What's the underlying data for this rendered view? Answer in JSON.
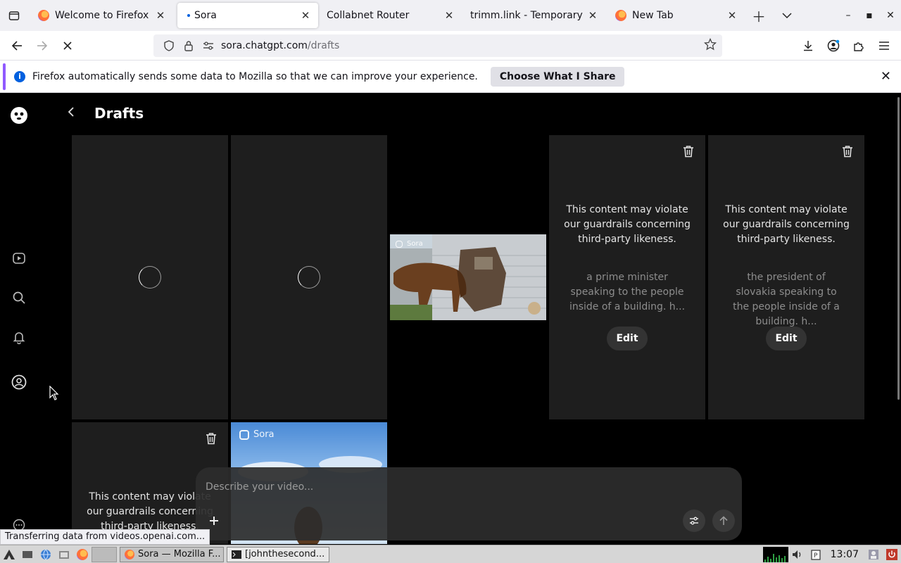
{
  "browser": {
    "tabs": [
      {
        "title": "Welcome to Firefox",
        "active": false
      },
      {
        "title": "Sora",
        "active": true
      },
      {
        "title": "Collabnet Router",
        "active": false
      },
      {
        "title": "trimm.link - Temporary U",
        "active": false
      },
      {
        "title": "New Tab",
        "active": false
      }
    ],
    "url_host": "sora.chatgpt.com",
    "url_path": "/drafts",
    "notification": {
      "message": "Firefox automatically sends some data to Mozilla so that we can improve your experience.",
      "button_label": "Choose What I Share"
    },
    "status_text": "Transferring data from videos.openai.com..."
  },
  "page": {
    "title": "Drafts",
    "sidebar_icons": [
      "sora-logo-icon",
      "video-icon",
      "search-icon",
      "bell-icon",
      "profile-icon",
      "more-icon"
    ],
    "drafts": [
      {
        "state": "loading"
      },
      {
        "state": "loading"
      },
      {
        "state": "video",
        "watermark": "Sora"
      },
      {
        "state": "blocked",
        "warning": "This content may violate our guardrails concerning third-party likeness.",
        "prompt": "a prime minister speaking to the people inside of a building. h...",
        "edit_label": "Edit"
      },
      {
        "state": "blocked",
        "warning": "This content may violate our guardrails concerning third-party likeness.",
        "prompt": "the president of slovakia speaking to the people inside of a building. h...",
        "edit_label": "Edit"
      },
      {
        "state": "blocked",
        "warning": "This content may violate our guardrails concerning third-party likeness."
      },
      {
        "state": "video",
        "watermark": "Sora"
      }
    ],
    "composer": {
      "placeholder": "Describe your video..."
    }
  },
  "taskbar": {
    "tasks": [
      {
        "label": "Sora — Mozilla F...",
        "active": true
      },
      {
        "label": "[johnthesecond...",
        "active": false
      }
    ],
    "clock": "13:07"
  }
}
